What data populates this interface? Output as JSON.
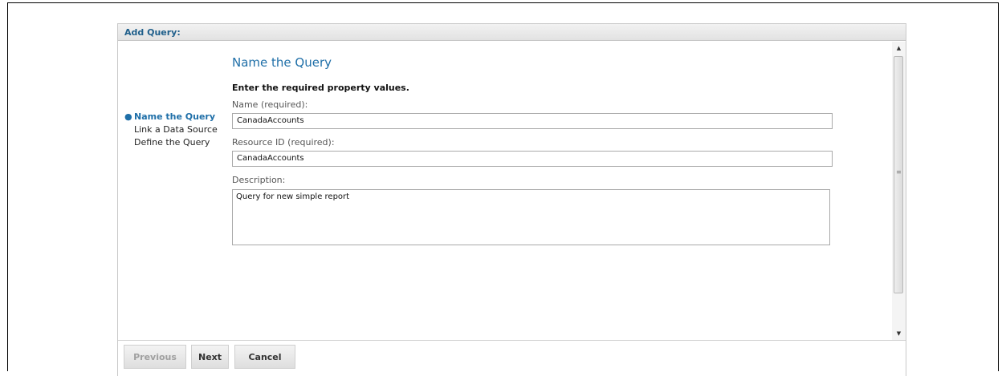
{
  "dialog": {
    "title": "Add Query:"
  },
  "wizard": {
    "steps": [
      {
        "label": "Name the Query",
        "active": true
      },
      {
        "label": "Link a Data Source",
        "active": false
      },
      {
        "label": "Define the Query",
        "active": false
      }
    ],
    "active_bullet": "●"
  },
  "form": {
    "title": "Name the Query",
    "instructions": "Enter the required property values.",
    "name_label": "Name (required):",
    "name_value": "CanadaAccounts",
    "resource_id_label": "Resource ID (required):",
    "resource_id_value": "CanadaAccounts",
    "description_label": "Description:",
    "description_value": "Query for new simple report"
  },
  "buttons": {
    "previous": "Previous",
    "next": "Next",
    "cancel": "Cancel"
  },
  "scrollbar": {
    "up_glyph": "▲",
    "down_glyph": "▼",
    "grip_glyph": "≡"
  }
}
